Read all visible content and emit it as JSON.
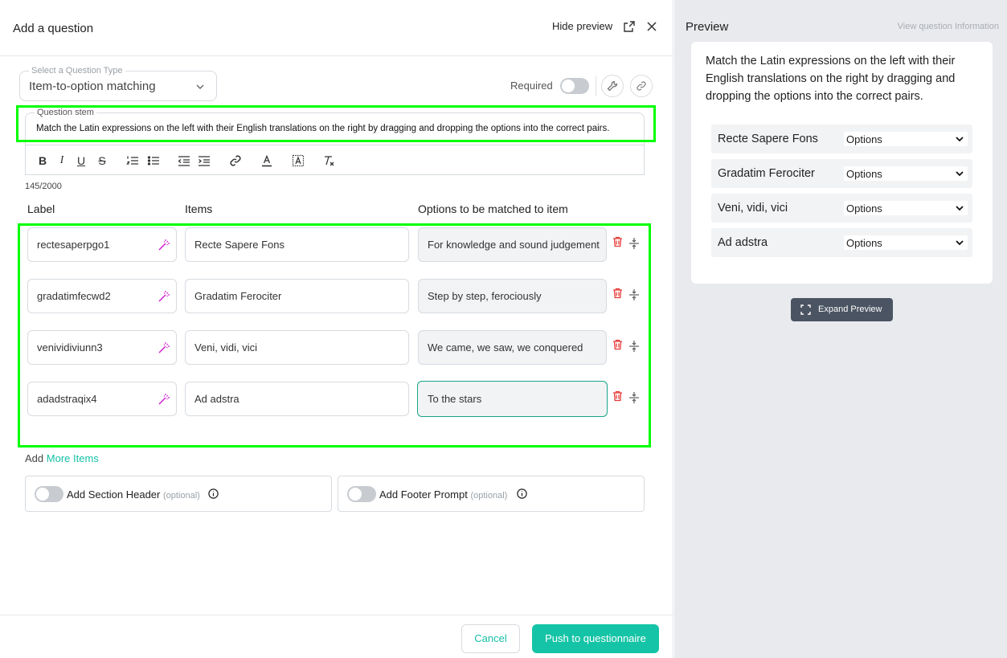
{
  "header": {
    "title": "Add a question",
    "hide_preview": "Hide preview"
  },
  "question_type": {
    "label": "Select a Question Type",
    "value": "Item-to-option matching"
  },
  "required": {
    "label": "Required",
    "on": false
  },
  "stem": {
    "label": "Question stem",
    "text": "Match the Latin expressions on the left with their English translations on the right by dragging and dropping the options into the correct pairs.",
    "char_count": "145/2000"
  },
  "toolbar": [
    "bold-icon",
    "italic-icon",
    "underline-icon",
    "strikethrough-icon",
    "ordered-list-icon",
    "bullet-list-icon",
    "outdent-icon",
    "indent-icon",
    "link-icon",
    "text-color-icon",
    "highlight-icon",
    "clear-format-icon"
  ],
  "columns": {
    "label": "Label",
    "items": "Items",
    "options": "Options to be matched to item"
  },
  "rows": [
    {
      "label": "rectesaperpgo1",
      "item": "Recte Sapere Fons",
      "option": "For knowledge and sound judgement"
    },
    {
      "label": "gradatimfecwd2",
      "item": "Gradatim Ferociter",
      "option": "Step by step, ferociously"
    },
    {
      "label": "venividiviunn3",
      "item": "Veni, vidi, vici",
      "option": "We came, we saw, we conquered"
    },
    {
      "label": "adadstraqix4",
      "item": "Ad adstra",
      "option": "To the stars"
    }
  ],
  "add_more": {
    "prefix": "Add",
    "link": "More Items"
  },
  "section_header": {
    "label": "Add Section Header",
    "optional": "(optional)"
  },
  "footer_prompt": {
    "label": "Add Footer Prompt",
    "optional": "(optional)"
  },
  "buttons": {
    "cancel": "Cancel",
    "push": "Push to questionnaire"
  },
  "preview": {
    "title": "Preview",
    "view_info": "View question Information",
    "question": "Match the Latin expressions on the left with their English translations on the right by dragging and dropping the options into the correct pairs.",
    "rows": [
      {
        "item": "Recte Sapere Fons",
        "select": "Options"
      },
      {
        "item": "Gradatim Ferociter",
        "select": "Options"
      },
      {
        "item": "Veni, vidi, vici",
        "select": "Options"
      },
      {
        "item": "Ad adstra",
        "select": "Options"
      }
    ],
    "expand": "Expand Preview"
  },
  "colors": {
    "accent": "#15c4a6",
    "highlight_box": "#00ff00",
    "wand": "#d21fd1",
    "trash": "#e53935",
    "expand_btn": "#4a5462"
  }
}
